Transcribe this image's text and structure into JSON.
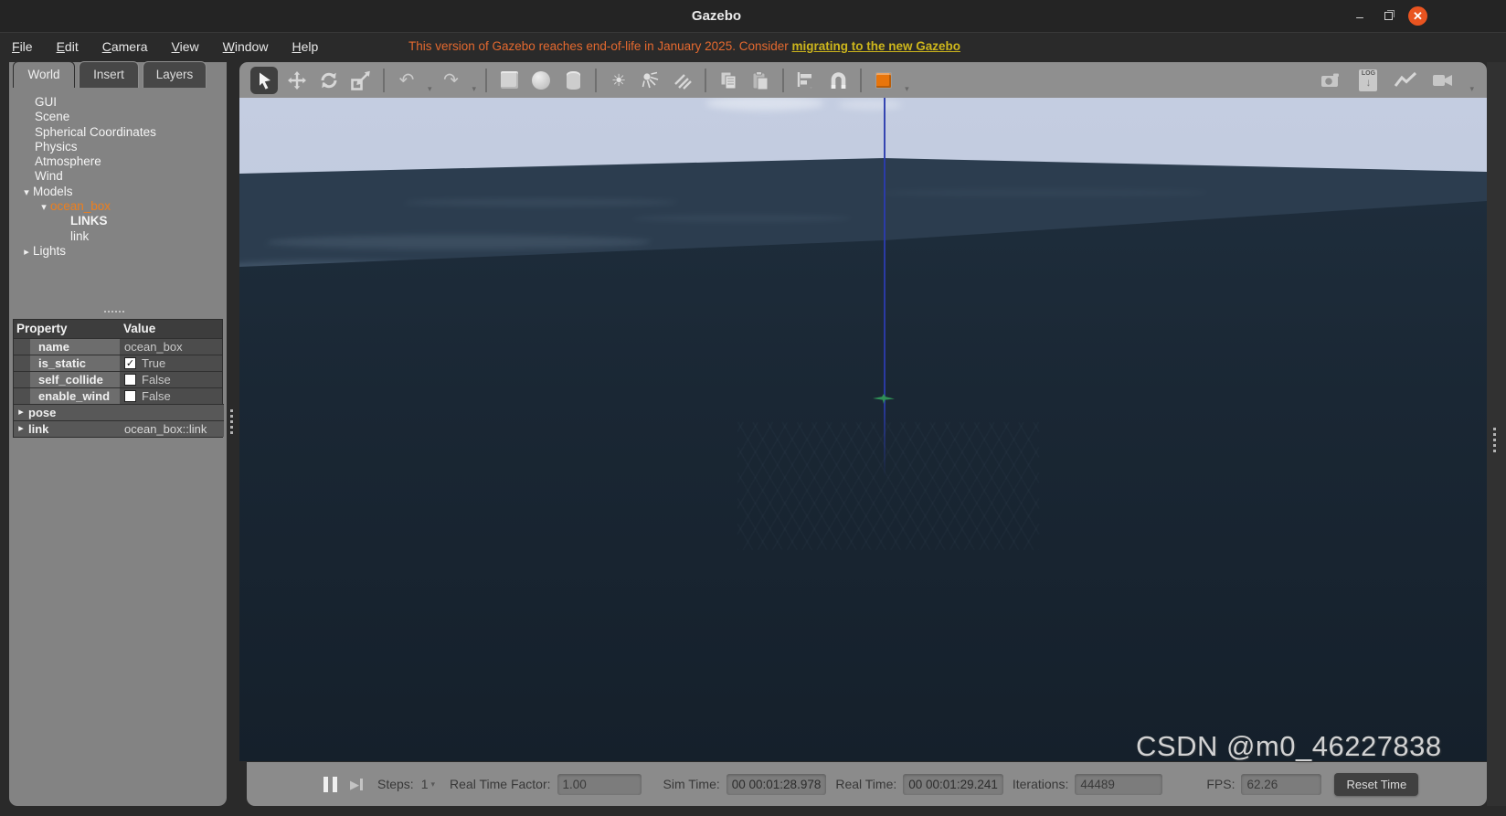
{
  "window": {
    "title": "Gazebo",
    "controls": {
      "minimize": "–",
      "close": "✕"
    }
  },
  "menu": {
    "items": [
      {
        "label": "File"
      },
      {
        "label": "Edit"
      },
      {
        "label": "Camera"
      },
      {
        "label": "View"
      },
      {
        "label": "Window"
      },
      {
        "label": "Help"
      }
    ],
    "warning_text": "This version of Gazebo reaches end-of-life in January 2025. Consider ",
    "warning_link": "migrating to the new Gazebo"
  },
  "panel": {
    "tabs": [
      {
        "label": "World"
      },
      {
        "label": "Insert"
      },
      {
        "label": "Layers"
      }
    ],
    "tree": [
      {
        "label": "GUI"
      },
      {
        "label": "Scene"
      },
      {
        "label": "Spherical Coordinates"
      },
      {
        "label": "Physics"
      },
      {
        "label": "Atmosphere"
      },
      {
        "label": "Wind"
      },
      {
        "label": "Models",
        "arrow": "▾"
      },
      {
        "label": "ocean_box",
        "arrow": "▾",
        "selected": true
      },
      {
        "label": "LINKS"
      },
      {
        "label": "link"
      },
      {
        "label": "Lights",
        "arrow": "▸"
      }
    ],
    "properties": {
      "headers": [
        "Property",
        "Value"
      ],
      "rows": [
        {
          "label": "name",
          "value": "ocean_box"
        },
        {
          "label": "is_static",
          "value": "True",
          "check": "✓"
        },
        {
          "label": "self_collide",
          "value": "False",
          "check": ""
        },
        {
          "label": "enable_wind",
          "value": "False",
          "check": ""
        },
        {
          "label": "pose",
          "arrow": "▸",
          "value": ""
        },
        {
          "label": "link",
          "arrow": "▸",
          "value": "ocean_box::link"
        }
      ]
    }
  },
  "toolbar": {
    "icon_names": [
      "select-tool",
      "translate-tool",
      "rotate-tool",
      "scale-tool",
      "undo",
      "redo",
      "box-shape",
      "sphere-shape",
      "cylinder-shape",
      "point-light",
      "spot-light",
      "directional-light",
      "copy",
      "paste",
      "align",
      "snap",
      "view-angle",
      "screenshot",
      "data-logger",
      "plot",
      "record-video"
    ],
    "log_label": "LOG",
    "log_arrow": "↓"
  },
  "icons": {
    "caret": "▾",
    "expand_open": "▾",
    "expand_closed": "▸",
    "undo": "↶",
    "redo": "↷",
    "sun": "☀",
    "play": "▶"
  },
  "statusbar": {
    "steps_label": "Steps:",
    "steps_value": "1",
    "rtf_label": "Real Time Factor:",
    "rtf_value": "1.00",
    "sim_time_label": "Sim Time:",
    "sim_time_value": "00 00:01:28.978",
    "real_time_label": "Real Time:",
    "real_time_value": "00 00:01:29.241",
    "iterations_label": "Iterations:",
    "iterations_value": "44489",
    "fps_label": "FPS:",
    "fps_value": "62.26",
    "reset_label": "Reset Time"
  },
  "watermark": "CSDN @m0_46227838",
  "colors": {
    "accent_orange": "#ee7f1d",
    "warning_text": "#e4692f",
    "warning_link": "#cdb61c",
    "close_button": "#e95420",
    "sky_top": "#c4cde1",
    "ocean_far": "#2c3d4f",
    "ocean_near": "#1a2734",
    "axis_blue": "#2b3cae",
    "marker_green": "#2f8f55",
    "view_cube_orange": "#e8750c"
  }
}
